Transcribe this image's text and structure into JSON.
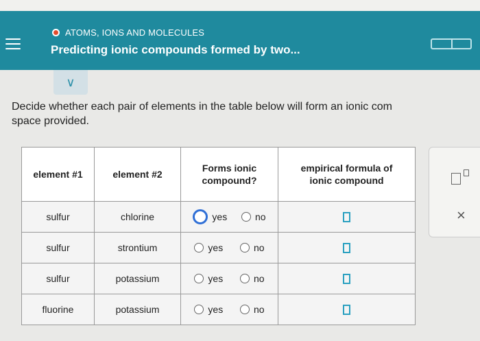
{
  "header": {
    "topic": "ATOMS, IONS AND MOLECULES",
    "title": "Predicting ionic compounds formed by two..."
  },
  "question": {
    "line1": "Decide whether each pair of elements in the table below will form an ionic com",
    "line2": "space provided."
  },
  "table": {
    "headers": [
      "element #1",
      "element #2",
      "Forms ionic compound?",
      "empirical formula of ionic compound"
    ],
    "rows": [
      {
        "e1": "sulfur",
        "e2": "chlorine",
        "yes": "yes",
        "no": "no"
      },
      {
        "e1": "sulfur",
        "e2": "strontium",
        "yes": "yes",
        "no": "no"
      },
      {
        "e1": "sulfur",
        "e2": "potassium",
        "yes": "yes",
        "no": "no"
      },
      {
        "e1": "fluorine",
        "e2": "potassium",
        "yes": "yes",
        "no": "no"
      }
    ]
  },
  "side_panel": {
    "close_symbol": "×"
  },
  "chevron": "∨",
  "colors": {
    "header": "#1f8a9e",
    "accent": "#2aa0c0",
    "focus": "#2f6fd6"
  }
}
